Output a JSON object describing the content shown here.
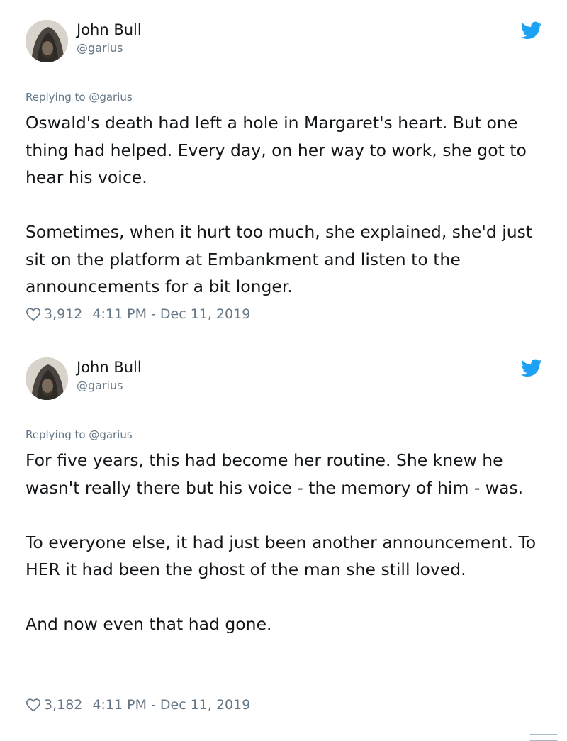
{
  "tweets": [
    {
      "author_name": "John Bull",
      "author_handle": "@garius",
      "replying_to": "Replying to @garius",
      "paragraphs": [
        "Oswald's death had left a hole in Margaret's heart. But one thing had helped. Every day, on her way to work, she got to hear his voice.",
        "Sometimes, when it hurt too much, she explained, she'd just sit on the platform at Embankment and listen to the announcements for a bit longer."
      ],
      "likes": "3,912",
      "timestamp": "4:11 PM - Dec 11, 2019",
      "avatar_icon": "hooded-figure-avatar",
      "brand_icon": "twitter-bird-icon",
      "like_icon": "heart-outline-icon"
    },
    {
      "author_name": "John Bull",
      "author_handle": "@garius",
      "replying_to": "Replying to @garius",
      "paragraphs": [
        "For five years, this had become her routine. She knew he wasn't really there but his voice - the memory of him - was.",
        "To everyone else, it had just been another announcement. To HER it had been the ghost of the man she still loved.",
        "And now even that had gone."
      ],
      "likes": "3,182",
      "timestamp": "4:11 PM - Dec 11, 2019",
      "avatar_icon": "hooded-figure-avatar",
      "brand_icon": "twitter-bird-icon",
      "like_icon": "heart-outline-icon"
    }
  ],
  "colors": {
    "text_primary": "#14171a",
    "text_secondary": "#657786",
    "twitter_blue": "#1da1f2",
    "background": "#ffffff"
  }
}
